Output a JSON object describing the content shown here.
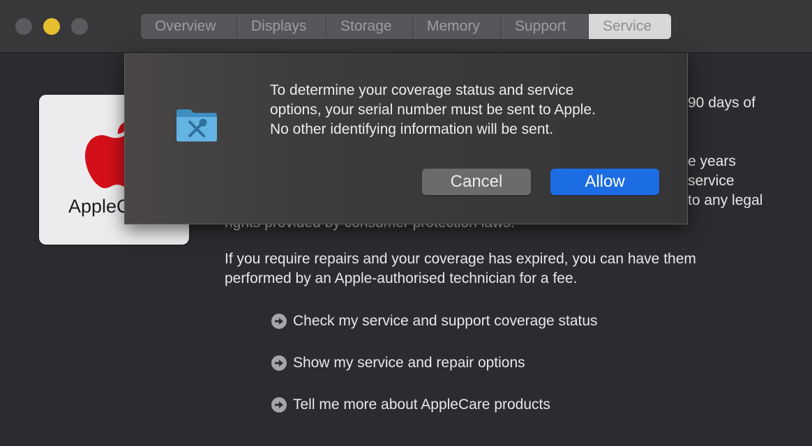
{
  "window": {
    "tabs": [
      {
        "label": "Overview"
      },
      {
        "label": "Displays"
      },
      {
        "label": "Storage"
      },
      {
        "label": "Memory"
      },
      {
        "label": "Support"
      },
      {
        "label": "Service",
        "active": true
      }
    ]
  },
  "card": {
    "label": "AppleCare",
    "logo_color": "#d30f1a"
  },
  "content": {
    "partial_line_1": "90 days of",
    "partial_line_2": "e years",
    "partial_line_3": "service",
    "partial_line_4": "to any legal",
    "partial_line_5": "rights provided by consumer protection laws.",
    "paragraph_line_1": "If you require repairs and your coverage has expired, you can have them",
    "paragraph_line_2": "performed by an Apple-authorised technician for a fee.",
    "links": [
      {
        "label": "Check my service and support coverage status",
        "icon": "arrow-circle-icon"
      },
      {
        "label": "Show my service and repair options",
        "icon": "arrow-circle-icon"
      },
      {
        "label": "Tell me more about AppleCare products",
        "icon": "arrow-circle-icon"
      }
    ]
  },
  "dialog": {
    "icon": "utilities-folder-icon",
    "message_line_1": "To determine your coverage status and service",
    "message_line_2": "options, your serial number must be sent to Apple.",
    "message_line_3": "No other identifying information will be sent.",
    "cancel_label": "Cancel",
    "allow_label": "Allow",
    "accent_color": "#1c6ce3"
  }
}
